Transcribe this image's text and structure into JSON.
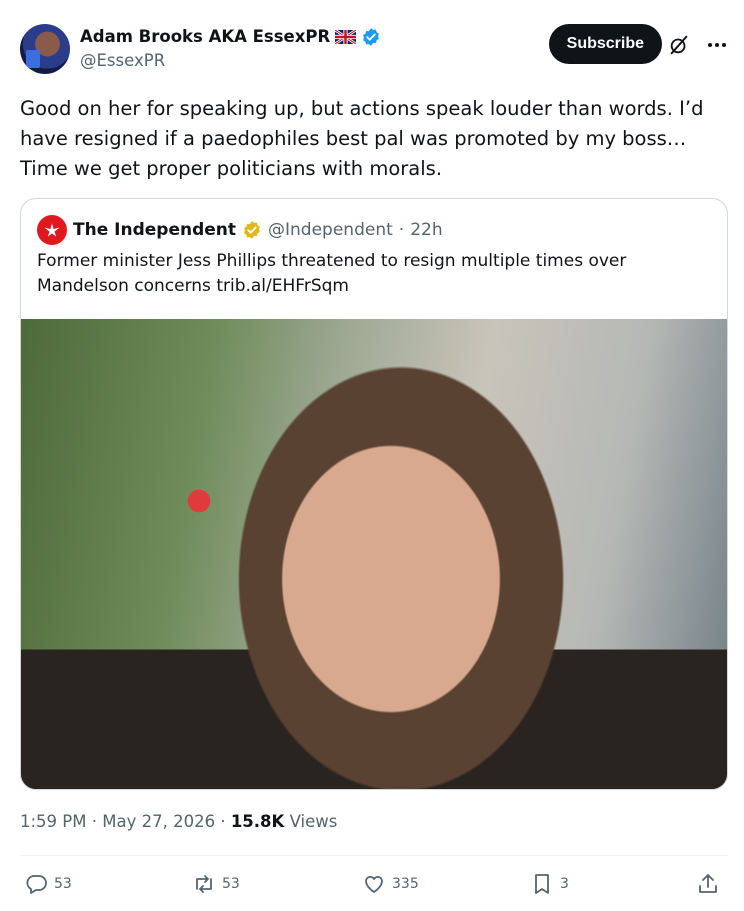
{
  "author": {
    "name": "Adam Brooks AKA EssexPR",
    "handle": "@EssexPR",
    "flag_icon": "uk-flag-icon",
    "verified_icon": "blue-verified-badge-icon"
  },
  "header": {
    "subscribe_label": "Subscribe",
    "grok_icon": "grok-icon",
    "more_icon": "more-options-icon"
  },
  "tweet": {
    "text": "Good on her for speaking up, but actions speak louder than words. I’d have resigned if a paedophiles best pal was promoted by my boss… Time we get proper politicians with morals."
  },
  "quote": {
    "name": "The Independent",
    "handle": "@Independent",
    "separator": "·",
    "age": "22h",
    "text": "Former minister Jess Phillips threatened to resign multiple times over Mandelson concerns trib.al/EHFrSqm",
    "logo_icon": "eagle-logo-icon",
    "badge_icon": "gold-verified-badge-icon"
  },
  "meta": {
    "time": "1:59 PM",
    "sep1": "·",
    "date": "May 27, 2026",
    "sep2": "·",
    "views_count": "15.8K",
    "views_label": "Views"
  },
  "actions": {
    "replies": "53",
    "reposts": "53",
    "likes": "335",
    "bookmarks": "3"
  },
  "colors": {
    "text": "#0f1419",
    "secondary": "#536471",
    "border": "#cfd9de",
    "verified_blue": "#1d9bf0",
    "gold": "#e2b719",
    "independent_red": "#e0191e"
  }
}
